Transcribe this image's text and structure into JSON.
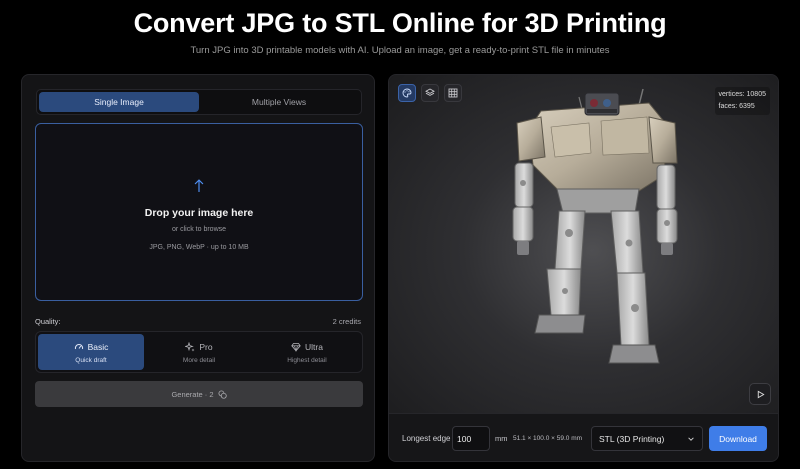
{
  "header": {
    "title": "Convert JPG to STL Online for 3D Printing",
    "subtitle": "Turn JPG into 3D printable models with AI. Upload an image, get a ready-to-print STL file in minutes"
  },
  "upload": {
    "tabs": [
      {
        "label": "Single Image",
        "active": true
      },
      {
        "label": "Multiple Views",
        "active": false
      }
    ],
    "dropzone": {
      "icon": "upload-arrow-icon",
      "title": "Drop your image here",
      "subtitle": "or click to browse",
      "formats": "JPG, PNG, WebP · up to 10 MB"
    },
    "quality": {
      "label": "Quality:",
      "credits": "2 credits",
      "options": [
        {
          "name": "Basic",
          "desc": "Quick draft",
          "icon": "gauge-icon",
          "active": true
        },
        {
          "name": "Pro",
          "desc": "More detail",
          "icon": "sparkles-icon",
          "active": false
        },
        {
          "name": "Ultra",
          "desc": "Highest detail",
          "icon": "gem-icon",
          "active": false
        }
      ]
    },
    "generate_label": "Generate · 2"
  },
  "viewer": {
    "view_buttons": [
      "palette-icon",
      "layers-icon",
      "grid-icon"
    ],
    "stats": {
      "vertices": "vertices: 10805",
      "faces": "faces: 6395"
    },
    "play_icon": "play-icon"
  },
  "export": {
    "edge_label": "Longest edge",
    "edge_value": "100",
    "unit": "mm",
    "dimensions": "51.1 × 100.0 × 59.0 mm",
    "format": "STL (3D Printing)",
    "download_label": "Download"
  },
  "colors": {
    "accent": "#3f7de8",
    "active_tab": "#2b4a7d",
    "background": "#000000",
    "panel": "#141416"
  }
}
